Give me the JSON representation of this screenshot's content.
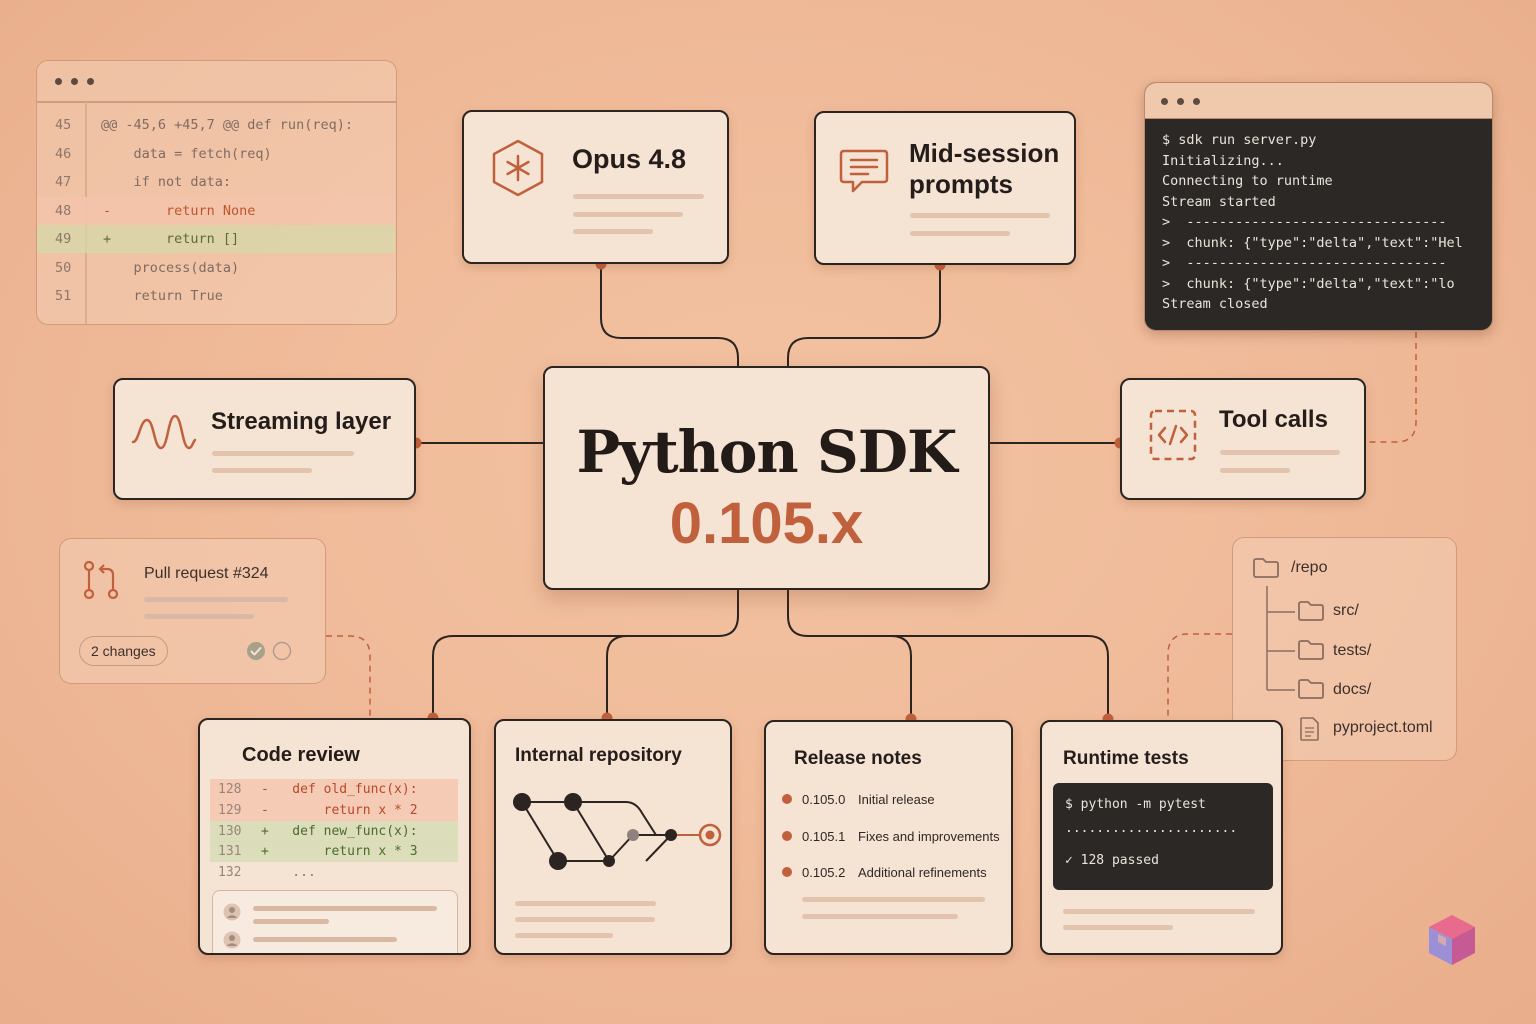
{
  "center": {
    "title": "Python SDK",
    "version": "0.105.x"
  },
  "nodes": {
    "opus": {
      "title": "Opus 4.8"
    },
    "mid_session": {
      "title_line1": "Mid-session",
      "title_line2": "prompts"
    },
    "streaming": {
      "title": "Streaming layer"
    },
    "tool_calls": {
      "title": "Tool calls"
    },
    "code_review": {
      "title": "Code review",
      "lines": [
        {
          "num": "128",
          "kind": "del",
          "text": "-   def old_func(x):"
        },
        {
          "num": "129",
          "kind": "del",
          "text": "-       return x * 2"
        },
        {
          "num": "130",
          "kind": "add",
          "text": "+   def new_func(x):"
        },
        {
          "num": "131",
          "kind": "add",
          "text": "+       return x * 3"
        },
        {
          "num": "132",
          "kind": "plain",
          "text": "    ..."
        }
      ]
    },
    "internal_repo": {
      "title": "Internal repository"
    },
    "release_notes": {
      "title": "Release notes",
      "items": [
        {
          "version": "0.105.0",
          "note": "Initial release"
        },
        {
          "version": "0.105.1",
          "note": "Fixes and improvements"
        },
        {
          "version": "0.105.2",
          "note": "Additional refinements"
        }
      ]
    },
    "runtime_tests": {
      "title": "Runtime tests",
      "command": "$ python -m pytest",
      "dots": "......................",
      "result": "✓ 128 passed"
    }
  },
  "diff_panel": {
    "lines": [
      {
        "num": "45",
        "kind": "plain",
        "marker": "",
        "text": "@@ -45,6 +45,7 @@ def run(req):"
      },
      {
        "num": "46",
        "kind": "plain",
        "marker": "",
        "text": "    data = fetch(req)"
      },
      {
        "num": "47",
        "kind": "plain",
        "marker": "",
        "text": "    if not data:"
      },
      {
        "num": "48",
        "kind": "del",
        "marker": "-",
        "text": "        return None"
      },
      {
        "num": "49",
        "kind": "add",
        "marker": "+",
        "text": "        return []"
      },
      {
        "num": "50",
        "kind": "plain",
        "marker": "",
        "text": "    process(data)"
      },
      {
        "num": "51",
        "kind": "plain",
        "marker": "",
        "text": "    return True"
      }
    ]
  },
  "terminal": {
    "lines": [
      "$ sdk run server.py",
      "Initializing...",
      "Connecting to runtime",
      "Stream started",
      ">  --------------------------------",
      ">  chunk: {\"type\":\"delta\",\"text\":\"Hel",
      ">  --------------------------------",
      ">  chunk: {\"type\":\"delta\",\"text\":\"lo",
      "Stream closed"
    ]
  },
  "pull_request": {
    "title": "Pull request #324",
    "badge": "2 changes"
  },
  "repo_tree": {
    "root": "/repo",
    "items": [
      "src/",
      "tests/",
      "docs/",
      "pyproject.toml"
    ]
  },
  "colors": {
    "accent": "#c0603c",
    "ink": "#2c2421",
    "card": "#f5e3d3",
    "background": "#efb998",
    "terminal": "#2b2826"
  }
}
